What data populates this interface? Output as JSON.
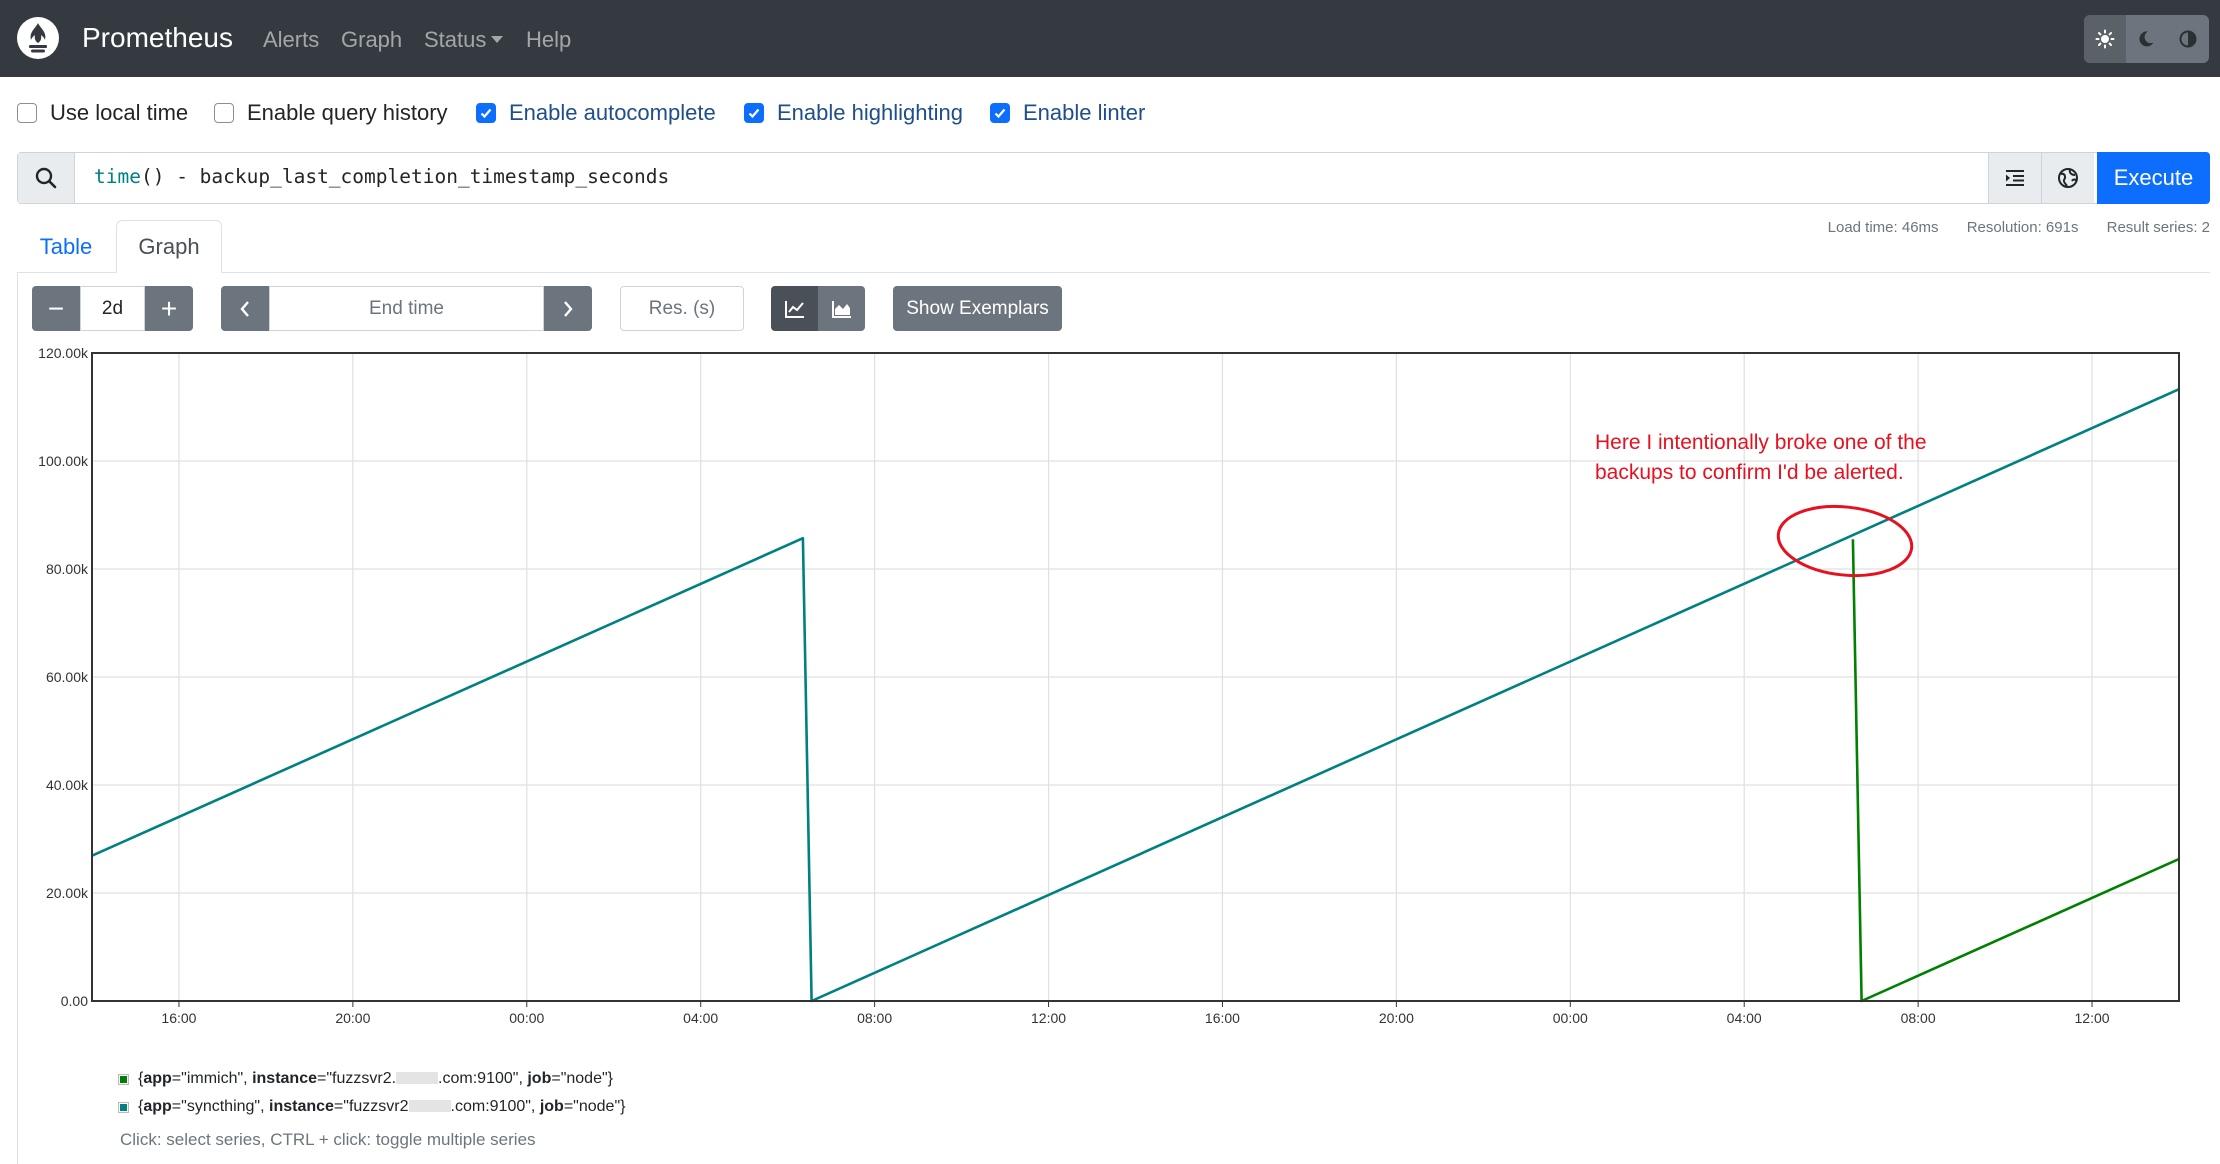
{
  "navbar": {
    "brand": "Prometheus",
    "links": [
      "Alerts",
      "Graph",
      "Status",
      "Help"
    ],
    "theme_buttons": [
      "sun-icon",
      "moon-icon",
      "half-circle-icon"
    ]
  },
  "options": [
    {
      "label": "Use local time",
      "checked": false
    },
    {
      "label": "Enable query history",
      "checked": false
    },
    {
      "label": "Enable autocomplete",
      "checked": true
    },
    {
      "label": "Enable highlighting",
      "checked": true
    },
    {
      "label": "Enable linter",
      "checked": true
    }
  ],
  "expression": {
    "fn": "time",
    "rest": "() - backup_last_completion_timestamp_seconds",
    "execute_label": "Execute"
  },
  "stats": {
    "load_time": "Load time: 46ms",
    "resolution": "Resolution: 691s",
    "result_series": "Result series: 2"
  },
  "tabs": {
    "table": "Table",
    "graph": "Graph"
  },
  "controls": {
    "minus": "−",
    "range": "2d",
    "plus": "+",
    "end_time_placeholder": "End time",
    "res_placeholder": "Res. (s)",
    "show_exemplars": "Show Exemplars"
  },
  "annotation": {
    "line1": "Here I intentionally broke one of the",
    "line2": "backups to confirm I'd be alerted."
  },
  "legend": {
    "hint": "Click: select series, CTRL + click: toggle multiple series"
  },
  "chart_data": {
    "type": "line",
    "y_ticks": [
      "120.00k",
      "100.00k",
      "80.00k",
      "60.00k",
      "40.00k",
      "20.00k",
      "0.00"
    ],
    "x_ticks": [
      "16:00",
      "20:00",
      "00:00",
      "04:00",
      "08:00",
      "12:00",
      "16:00",
      "20:00",
      "00:00",
      "04:00",
      "08:00",
      "12:00"
    ],
    "ylim": [
      0,
      120000
    ],
    "grid": true,
    "x_unit": "hours since 14:00 on the first day shown",
    "xlim": [
      0,
      48
    ],
    "series": [
      {
        "app": "immich",
        "instance_prefix": "fuzzsvr2.",
        "instance_suffix": ".com:9100",
        "job": "node",
        "color": "#008000",
        "points": [
          [
            40.5,
            85500
          ],
          [
            40.7,
            0
          ],
          [
            48,
            26300
          ]
        ]
      },
      {
        "app": "syncthing",
        "instance_prefix": "fuzzsvr2",
        "instance_suffix": ".com:9100",
        "job": "node",
        "color": "#008080",
        "points": [
          [
            0,
            26900
          ],
          [
            16.35,
            85700
          ],
          [
            16.55,
            0
          ],
          [
            48,
            113300
          ]
        ]
      }
    ]
  }
}
